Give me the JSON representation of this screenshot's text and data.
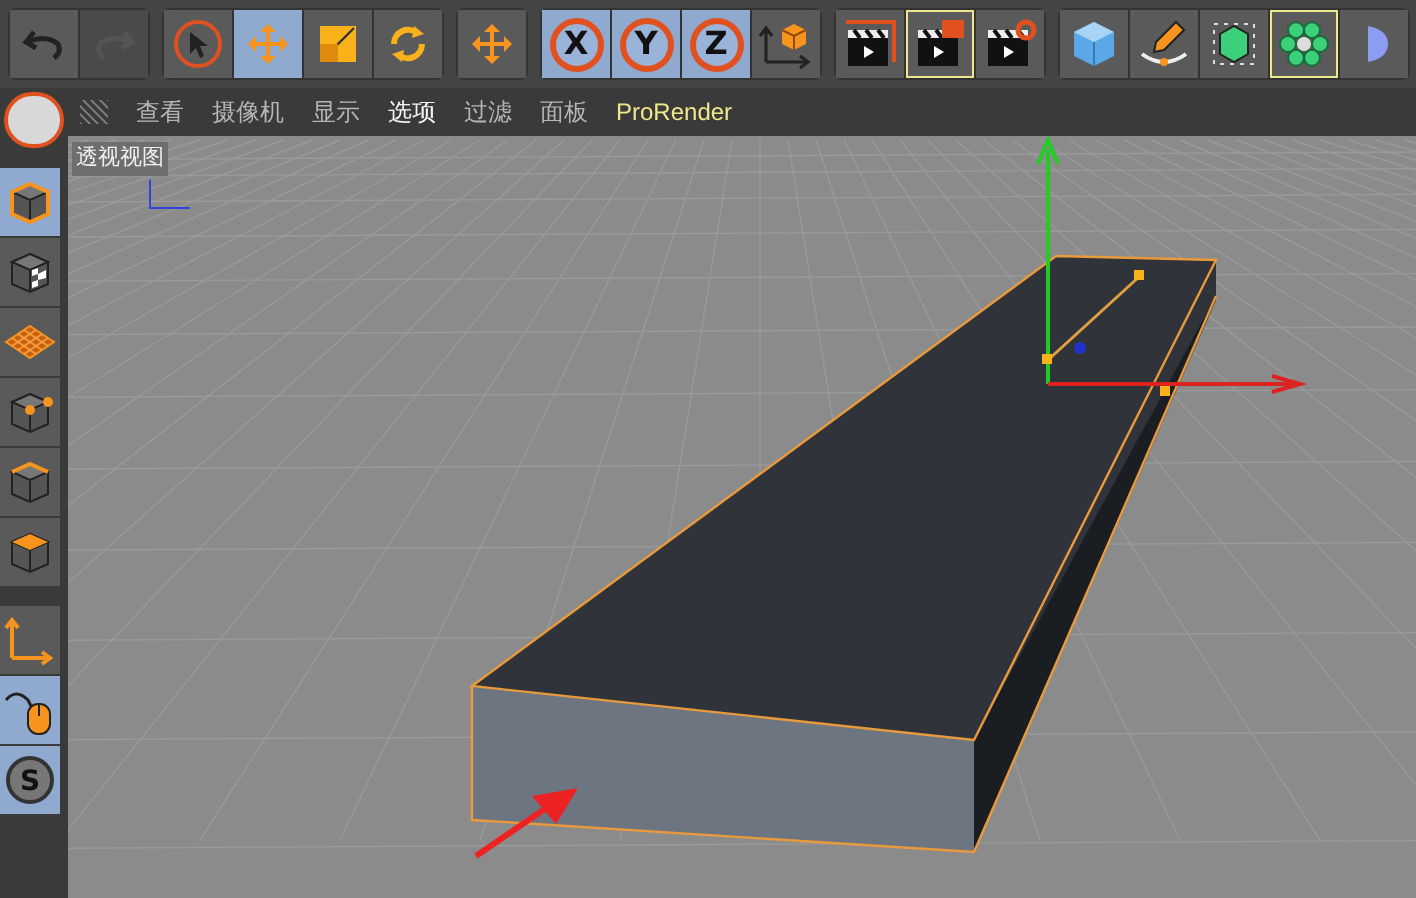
{
  "toolbar": {
    "groups": [
      [
        {
          "kind": "undo",
          "selected": false,
          "disabled": false,
          "highlighted": false
        },
        {
          "kind": "redo",
          "selected": false,
          "disabled": true,
          "highlighted": false
        }
      ],
      [
        {
          "kind": "select",
          "selected": false,
          "disabled": false,
          "highlighted": false
        },
        {
          "kind": "move",
          "selected": true,
          "disabled": false,
          "highlighted": false
        },
        {
          "kind": "scale",
          "selected": false,
          "disabled": false,
          "highlighted": false
        },
        {
          "kind": "rotate",
          "selected": false,
          "disabled": false,
          "highlighted": false
        }
      ],
      [
        {
          "kind": "move",
          "selected": false,
          "disabled": false,
          "highlighted": false
        }
      ],
      [
        {
          "kind": "axis",
          "label": "X",
          "selected": true,
          "disabled": false,
          "highlighted": false
        },
        {
          "kind": "axis",
          "label": "Y",
          "selected": true,
          "disabled": false,
          "highlighted": false
        },
        {
          "kind": "axis",
          "label": "Z",
          "selected": true,
          "disabled": false,
          "highlighted": false
        },
        {
          "kind": "coords",
          "selected": false,
          "disabled": false,
          "highlighted": false
        }
      ],
      [
        {
          "kind": "render-view",
          "selected": false,
          "disabled": false,
          "highlighted": false
        },
        {
          "kind": "render-region",
          "selected": false,
          "disabled": false,
          "highlighted": true
        },
        {
          "kind": "render-settings",
          "selected": false,
          "disabled": false,
          "highlighted": false
        }
      ],
      [
        {
          "kind": "cube",
          "selected": false,
          "disabled": false,
          "highlighted": false
        },
        {
          "kind": "pen",
          "selected": false,
          "disabled": false,
          "highlighted": false
        },
        {
          "kind": "subdivision",
          "selected": false,
          "disabled": false,
          "highlighted": false
        },
        {
          "kind": "cloner",
          "selected": false,
          "disabled": false,
          "highlighted": true
        },
        {
          "kind": "deformer",
          "selected": false,
          "disabled": false,
          "highlighted": false
        }
      ]
    ]
  },
  "menu": [
    {
      "label": "查看",
      "selected": false,
      "kind": "menu"
    },
    {
      "label": "摄像机",
      "selected": false,
      "kind": "menu"
    },
    {
      "label": "显示",
      "selected": false,
      "kind": "menu"
    },
    {
      "label": "选项",
      "selected": true,
      "kind": "menu"
    },
    {
      "label": "过滤",
      "selected": false,
      "kind": "menu"
    },
    {
      "label": "面板",
      "selected": false,
      "kind": "menu"
    },
    {
      "label": "ProRender",
      "selected": false,
      "kind": "plugin"
    }
  ],
  "left_tools": [
    [
      {
        "kind": "model",
        "selected": true
      },
      {
        "kind": "texture",
        "selected": false
      },
      {
        "kind": "workplane",
        "selected": false
      },
      {
        "kind": "points",
        "selected": false
      },
      {
        "kind": "edges",
        "selected": false
      },
      {
        "kind": "polygons",
        "selected": false
      }
    ],
    [
      {
        "kind": "axis",
        "selected": false
      },
      {
        "kind": "tweak",
        "selected": true
      },
      {
        "kind": "snap",
        "label": "S",
        "selected": true
      }
    ]
  ],
  "viewport": {
    "title": "透视视图"
  }
}
